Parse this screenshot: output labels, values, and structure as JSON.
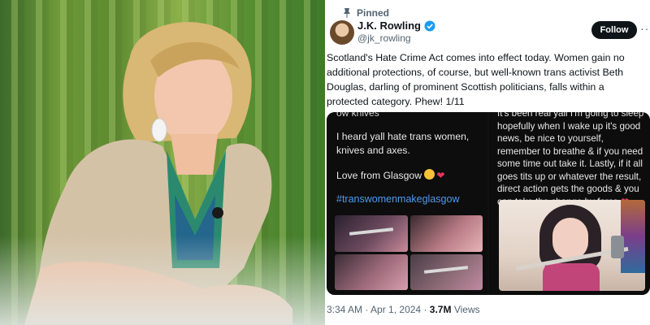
{
  "photo": {
    "description_icon": "portrait-photo"
  },
  "tweet": {
    "pinned_label": "Pinned",
    "author": {
      "name": "J.K. Rowling",
      "handle": "@jk_rowling",
      "verified": true
    },
    "follow_label": "Follow",
    "more_label": "···",
    "text": "Scotland's Hate Crime Act comes into effect today. Women gain no additional protections, of course, but well-known trans activist Beth Douglas, darling of prominent Scottish politicians, falls within a protected category. Phew! 1/11",
    "media": {
      "left": {
        "cut_top_text": "ow knives",
        "line1": "I heard yall hate trans women, knives and axes.",
        "line2": "Love from Glasgow",
        "hashtag": "#transwomenmakeglasgow"
      },
      "right": {
        "text": "It's been real yall I'm going to sleep hopefully when I wake up it's good news, be nice to yourself, remember to breathe & if you need some time out take it. Lastly, if it all goes tits up or whatever the result, direct action gets the goods & you can take the change by force"
      }
    },
    "meta": {
      "time": "3:34 AM",
      "separator": "·",
      "date": "Apr 1, 2024",
      "views_count": "3.7M",
      "views_label": "Views"
    }
  },
  "colors": {
    "accent": "#1d9bf0",
    "text_primary": "#0f1419",
    "text_secondary": "#536471",
    "follow_bg": "#0f1419",
    "hashtag": "#4d9bf0",
    "heart": "#e3345a"
  }
}
